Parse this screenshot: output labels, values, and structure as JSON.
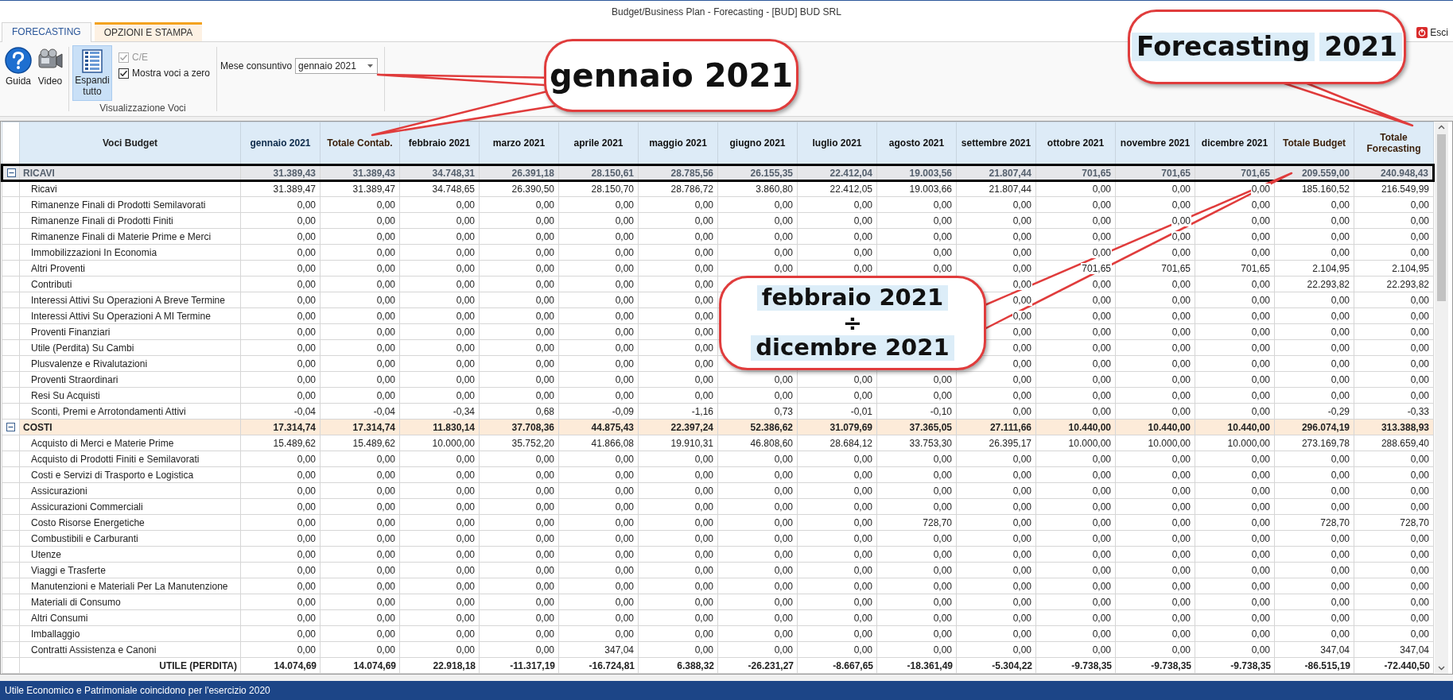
{
  "window": {
    "title": "Budget/Business Plan - Forecasting - [BUD] BUD SRL"
  },
  "exit_button": {
    "label": "Esci"
  },
  "tabs": [
    {
      "label": "FORECASTING",
      "selected": true
    },
    {
      "label": "OPZIONI E STAMPA",
      "selected": false
    }
  ],
  "ribbon": {
    "buttons": [
      {
        "label": "Guida",
        "kind": "help"
      },
      {
        "label": "Video",
        "kind": "video"
      }
    ],
    "expand_button": {
      "label": "Espandi tutto",
      "selected": true
    },
    "checkboxes": [
      {
        "label": "C/E",
        "checked": true,
        "disabled": true
      },
      {
        "label": "Mostra voci a zero",
        "checked": true,
        "disabled": false
      }
    ],
    "group_label": "Visualizzazione Voci",
    "month_field": {
      "label": "Mese consuntivo",
      "value": "gennaio 2021"
    }
  },
  "table": {
    "columns": [
      {
        "label": "Voci Budget"
      },
      {
        "label": "gennaio 2021",
        "kind": "actual"
      },
      {
        "label": "Totale Contab.",
        "kind": "total"
      },
      {
        "label": "febbraio 2021",
        "kind": "forecast"
      },
      {
        "label": "marzo 2021",
        "kind": "forecast"
      },
      {
        "label": "aprile 2021",
        "kind": "forecast"
      },
      {
        "label": "maggio 2021",
        "kind": "forecast"
      },
      {
        "label": "giugno 2021",
        "kind": "forecast"
      },
      {
        "label": "luglio 2021",
        "kind": "forecast"
      },
      {
        "label": "agosto 2021",
        "kind": "forecast"
      },
      {
        "label": "settembre 2021",
        "kind": "forecast"
      },
      {
        "label": "ottobre 2021",
        "kind": "forecast"
      },
      {
        "label": "novembre 2021",
        "kind": "forecast"
      },
      {
        "label": "dicembre 2021",
        "kind": "forecast"
      },
      {
        "label": "Totale Budget",
        "kind": "total"
      },
      {
        "label": "Totale Forecasting",
        "kind": "total"
      }
    ],
    "groups": [
      {
        "name": "RICAVI",
        "expanded": true,
        "selected": true,
        "totals": [
          "31.389,43",
          "31.389,43",
          "34.748,31",
          "26.391,18",
          "28.150,61",
          "28.785,56",
          "26.155,35",
          "22.412,04",
          "19.003,56",
          "21.807,44",
          "701,65",
          "701,65",
          "701,65",
          "209.559,00",
          "240.948,43"
        ],
        "rows": [
          {
            "label": "Ricavi",
            "cells": [
              "31.389,47",
              "31.389,47",
              "34.748,65",
              "26.390,50",
              "28.150,70",
              "28.786,72",
              "3.860,80",
              "22.412,05",
              "19.003,66",
              "21.807,44",
              "0,00",
              "0,00",
              "0,00",
              "185.160,52",
              "216.549,99"
            ]
          },
          {
            "label": "Rimanenze Finali di Prodotti Semilavorati",
            "cells": [
              "0,00",
              "0,00",
              "0,00",
              "0,00",
              "0,00",
              "0,00",
              "0,00",
              "0,00",
              "0,00",
              "0,00",
              "0,00",
              "0,00",
              "0,00",
              "0,00",
              "0,00"
            ]
          },
          {
            "label": "Rimanenze Finali di Prodotti Finiti",
            "cells": [
              "0,00",
              "0,00",
              "0,00",
              "0,00",
              "0,00",
              "0,00",
              "0,00",
              "0,00",
              "0,00",
              "0,00",
              "0,00",
              "0,00",
              "0,00",
              "0,00",
              "0,00"
            ]
          },
          {
            "label": "Rimanenze Finali di Materie Prime e Merci",
            "cells": [
              "0,00",
              "0,00",
              "0,00",
              "0,00",
              "0,00",
              "0,00",
              "0,00",
              "0,00",
              "0,00",
              "0,00",
              "0,00",
              "0,00",
              "0,00",
              "0,00",
              "0,00"
            ]
          },
          {
            "label": "Immobilizzazioni In Economia",
            "cells": [
              "0,00",
              "0,00",
              "0,00",
              "0,00",
              "0,00",
              "0,00",
              "0,00",
              "0,00",
              "0,00",
              "0,00",
              "0,00",
              "0,00",
              "0,00",
              "0,00",
              "0,00"
            ]
          },
          {
            "label": "Altri Proventi",
            "cells": [
              "0,00",
              "0,00",
              "0,00",
              "0,00",
              "0,00",
              "0,00",
              "0,00",
              "0,00",
              "0,00",
              "0,00",
              "701,65",
              "701,65",
              "701,65",
              "2.104,95",
              "2.104,95"
            ]
          },
          {
            "label": "Contributi",
            "cells": [
              "0,00",
              "0,00",
              "0,00",
              "0,00",
              "0,00",
              "0,00",
              null,
              null,
              null,
              "0,00",
              "0,00",
              "0,00",
              "0,00",
              "22.293,82",
              "22.293,82"
            ]
          },
          {
            "label": "Interessi Attivi Su Operazioni A Breve Termine",
            "cells": [
              "0,00",
              "0,00",
              "0,00",
              "0,00",
              "0,00",
              "0,00",
              null,
              null,
              null,
              "0,00",
              "0,00",
              "0,00",
              "0,00",
              "0,00",
              "0,00"
            ]
          },
          {
            "label": "Interessi Attivi Su Operazioni A MI Termine",
            "cells": [
              "0,00",
              "0,00",
              "0,00",
              "0,00",
              "0,00",
              "0,00",
              null,
              null,
              null,
              "0,00",
              "0,00",
              "0,00",
              "0,00",
              "0,00",
              "0,00"
            ]
          },
          {
            "label": "Proventi Finanziari",
            "cells": [
              "0,00",
              "0,00",
              "0,00",
              "0,00",
              "0,00",
              "0,00",
              null,
              null,
              null,
              "0,00",
              "0,00",
              "0,00",
              "0,00",
              "0,00",
              "0,00"
            ]
          },
          {
            "label": "Utile (Perdita) Su Cambi",
            "cells": [
              "0,00",
              "0,00",
              "0,00",
              "0,00",
              "0,00",
              "0,00",
              null,
              null,
              null,
              "0,00",
              "0,00",
              "0,00",
              "0,00",
              "0,00",
              "0,00"
            ]
          },
          {
            "label": "Plusvalenze e Rivalutazioni",
            "cells": [
              "0,00",
              "0,00",
              "0,00",
              "0,00",
              "0,00",
              "0,00",
              null,
              null,
              null,
              "0,00",
              "0,00",
              "0,00",
              "0,00",
              "0,00",
              "0,00"
            ]
          },
          {
            "label": "Proventi Straordinari",
            "cells": [
              "0,00",
              "0,00",
              "0,00",
              "0,00",
              "0,00",
              "0,00",
              "0,00",
              "0,00",
              "0,00",
              "0,00",
              "0,00",
              "0,00",
              "0,00",
              "0,00",
              "0,00"
            ]
          },
          {
            "label": "Resi Su Acquisti",
            "cells": [
              "0,00",
              "0,00",
              "0,00",
              "0,00",
              "0,00",
              "0,00",
              "0,00",
              "0,00",
              "0,00",
              "0,00",
              "0,00",
              "0,00",
              "0,00",
              "0,00",
              "0,00"
            ]
          },
          {
            "label": "Sconti, Premi e Arrotondamenti  Attivi",
            "cells": [
              "-0,04",
              "-0,04",
              "-0,34",
              "0,68",
              "-0,09",
              "-1,16",
              "0,73",
              "-0,01",
              "-0,10",
              "0,00",
              "0,00",
              "0,00",
              "0,00",
              "-0,29",
              "-0,33"
            ]
          }
        ]
      },
      {
        "name": "COSTI",
        "expanded": true,
        "selected": false,
        "totals": [
          "17.314,74",
          "17.314,74",
          "11.830,14",
          "37.708,36",
          "44.875,43",
          "22.397,24",
          "52.386,62",
          "31.079,69",
          "37.365,05",
          "27.111,66",
          "10.440,00",
          "10.440,00",
          "10.440,00",
          "296.074,19",
          "313.388,93"
        ],
        "rows": [
          {
            "label": "Acquisto di Merci e Materie Prime",
            "cells": [
              "15.489,62",
              "15.489,62",
              "10.000,00",
              "35.752,20",
              "41.866,08",
              "19.910,31",
              "46.808,60",
              "28.684,12",
              "33.753,30",
              "26.395,17",
              "10.000,00",
              "10.000,00",
              "10.000,00",
              "273.169,78",
              "288.659,40"
            ]
          },
          {
            "label": "Acquisto di Prodotti Finiti e Semilavorati",
            "cells": [
              "0,00",
              "0,00",
              "0,00",
              "0,00",
              "0,00",
              "0,00",
              "0,00",
              "0,00",
              "0,00",
              "0,00",
              "0,00",
              "0,00",
              "0,00",
              "0,00",
              "0,00"
            ]
          },
          {
            "label": "Costi e Servizi di Trasporto e Logistica",
            "cells": [
              "0,00",
              "0,00",
              "0,00",
              "0,00",
              "0,00",
              "0,00",
              "0,00",
              "0,00",
              "0,00",
              "0,00",
              "0,00",
              "0,00",
              "0,00",
              "0,00",
              "0,00"
            ]
          },
          {
            "label": "Assicurazioni",
            "cells": [
              "0,00",
              "0,00",
              "0,00",
              "0,00",
              "0,00",
              "0,00",
              "0,00",
              "0,00",
              "0,00",
              "0,00",
              "0,00",
              "0,00",
              "0,00",
              "0,00",
              "0,00"
            ]
          },
          {
            "label": "Assicurazioni Commerciali",
            "cells": [
              "0,00",
              "0,00",
              "0,00",
              "0,00",
              "0,00",
              "0,00",
              "0,00",
              "0,00",
              "0,00",
              "0,00",
              "0,00",
              "0,00",
              "0,00",
              "0,00",
              "0,00"
            ]
          },
          {
            "label": "Costo Risorse Energetiche",
            "cells": [
              "0,00",
              "0,00",
              "0,00",
              "0,00",
              "0,00",
              "0,00",
              "0,00",
              "0,00",
              "728,70",
              "0,00",
              "0,00",
              "0,00",
              "0,00",
              "728,70",
              "728,70"
            ]
          },
          {
            "label": "Combustibili e Carburanti",
            "cells": [
              "0,00",
              "0,00",
              "0,00",
              "0,00",
              "0,00",
              "0,00",
              "0,00",
              "0,00",
              "0,00",
              "0,00",
              "0,00",
              "0,00",
              "0,00",
              "0,00",
              "0,00"
            ]
          },
          {
            "label": "Utenze",
            "cells": [
              "0,00",
              "0,00",
              "0,00",
              "0,00",
              "0,00",
              "0,00",
              "0,00",
              "0,00",
              "0,00",
              "0,00",
              "0,00",
              "0,00",
              "0,00",
              "0,00",
              "0,00"
            ]
          },
          {
            "label": "Viaggi e Trasferte",
            "cells": [
              "0,00",
              "0,00",
              "0,00",
              "0,00",
              "0,00",
              "0,00",
              "0,00",
              "0,00",
              "0,00",
              "0,00",
              "0,00",
              "0,00",
              "0,00",
              "0,00",
              "0,00"
            ]
          },
          {
            "label": "Manutenzioni e Materiali Per La Manutenzione",
            "cells": [
              "0,00",
              "0,00",
              "0,00",
              "0,00",
              "0,00",
              "0,00",
              "0,00",
              "0,00",
              "0,00",
              "0,00",
              "0,00",
              "0,00",
              "0,00",
              "0,00",
              "0,00"
            ]
          },
          {
            "label": "Materiali di Consumo",
            "cells": [
              "0,00",
              "0,00",
              "0,00",
              "0,00",
              "0,00",
              "0,00",
              "0,00",
              "0,00",
              "0,00",
              "0,00",
              "0,00",
              "0,00",
              "0,00",
              "0,00",
              "0,00"
            ]
          },
          {
            "label": "Altri Consumi",
            "cells": [
              "0,00",
              "0,00",
              "0,00",
              "0,00",
              "0,00",
              "0,00",
              "0,00",
              "0,00",
              "0,00",
              "0,00",
              "0,00",
              "0,00",
              "0,00",
              "0,00",
              "0,00"
            ]
          },
          {
            "label": "Imballaggio",
            "cells": [
              "0,00",
              "0,00",
              "0,00",
              "0,00",
              "0,00",
              "0,00",
              "0,00",
              "0,00",
              "0,00",
              "0,00",
              "0,00",
              "0,00",
              "0,00",
              "0,00",
              "0,00"
            ]
          },
          {
            "label": "Contratti Assistenza e Canoni",
            "cells": [
              "0,00",
              "0,00",
              "0,00",
              "0,00",
              "347,04",
              "0,00",
              "0,00",
              "0,00",
              "0,00",
              "0,00",
              "0,00",
              "0,00",
              "0,00",
              "347,04",
              "347,04"
            ]
          }
        ]
      }
    ],
    "footer": {
      "label": "UTILE (PERDITA)",
      "cells": [
        "14.074,69",
        "14.074,69",
        "22.918,18",
        "-11.317,19",
        "-16.724,81",
        "6.388,32",
        "-26.231,27",
        "-8.667,65",
        "-18.361,49",
        "-5.304,22",
        "-9.738,35",
        "-9.738,35",
        "-9.738,35",
        "-86.515,19",
        "-72.440,50"
      ]
    }
  },
  "callouts": [
    {
      "kind": "stacked",
      "lines": [
        {
          "text": "gennaio 2021",
          "kind": "plain"
        }
      ]
    },
    {
      "kind": "inline",
      "lines": [
        {
          "text": "Forecasting",
          "kind": "highlight"
        },
        {
          "text": "2021",
          "kind": "highlight"
        }
      ]
    },
    {
      "kind": "stacked",
      "lines": [
        {
          "text": "febbraio 2021",
          "kind": "highlight"
        },
        {
          "text": "÷",
          "kind": "plain"
        },
        {
          "text": "dicembre 2021",
          "kind": "highlight"
        }
      ]
    }
  ],
  "status_bar": {
    "text": "Utile Economico e Patrimoniale coincidono per l'esercizio 2020"
  }
}
